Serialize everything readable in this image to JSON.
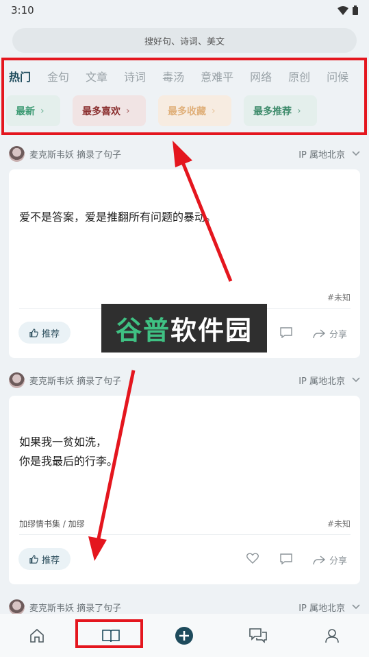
{
  "status": {
    "time": "3:10"
  },
  "search": {
    "placeholder": "搜好句、诗词、美文"
  },
  "tabs": [
    "热门",
    "金句",
    "文章",
    "诗词",
    "毒汤",
    "意难平",
    "网络",
    "原创",
    "问候"
  ],
  "chips": [
    "最新",
    "最多喜欢",
    "最多收藏",
    "最多推荐"
  ],
  "posts": [
    {
      "author": "麦克斯韦妖",
      "action": "摘录了句子",
      "ip": "IP 属地北京",
      "text_lines": [
        "爱不是答案，爱是推翻所有问题的暴动。"
      ],
      "tag": "#未知",
      "source": "",
      "recommend": "推荐",
      "share": "分享"
    },
    {
      "author": "麦克斯韦妖",
      "action": "摘录了句子",
      "ip": "IP 属地北京",
      "text_lines": [
        "如果我一贫如洗，",
        "你是我最后的行李。"
      ],
      "tag": "#未知",
      "source": "加缪情书集 / 加缪",
      "recommend": "推荐",
      "share": "分享"
    },
    {
      "author": "麦克斯韦妖",
      "action": "摘录了句子",
      "ip": "IP 属地北京"
    }
  ],
  "watermark": {
    "green": "谷普",
    "white": "软件园"
  },
  "colors": {
    "highlight": "#e4161e",
    "accent": "#1e4b5c"
  },
  "nav": [
    "home-icon",
    "book-icon",
    "add-icon",
    "chat-icon",
    "user-icon"
  ]
}
